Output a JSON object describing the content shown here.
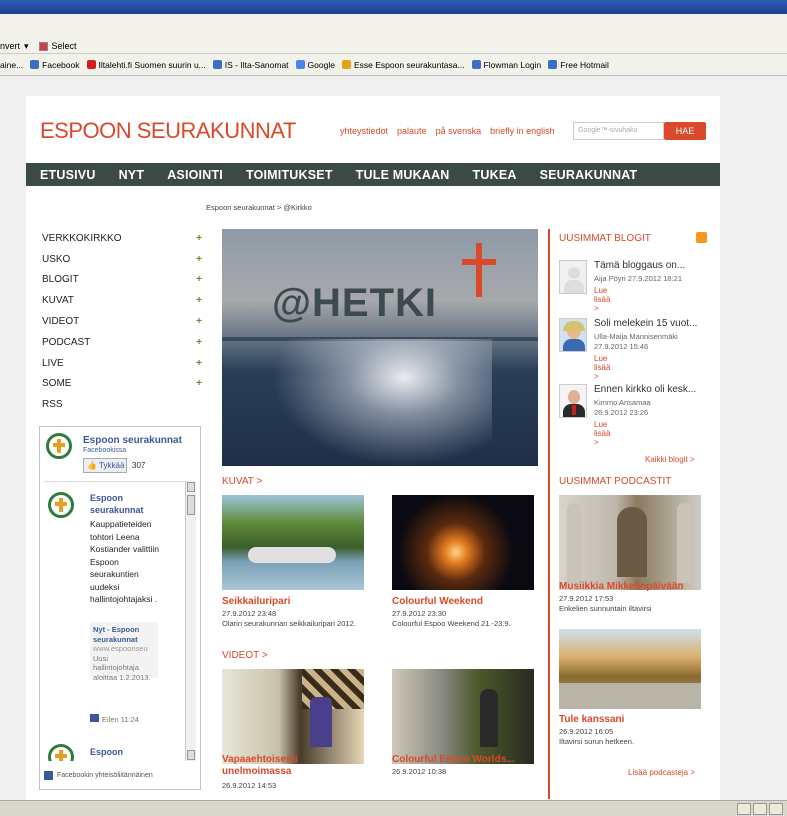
{
  "browser": {
    "toolbar_left": [
      "nvert",
      "Select"
    ],
    "favorites": [
      {
        "label": "aine...",
        "color": "#3b6fc4"
      },
      {
        "label": "Facebook",
        "color": "#3b5998"
      },
      {
        "label": "Iltalehti.fi  Suomen suurin u...",
        "color": "#d02020"
      },
      {
        "label": "IS - Ilta-Sanomat",
        "color": "#3b6fc4"
      },
      {
        "label": "Google",
        "color": "#4a86e8"
      },
      {
        "label": "Esse  Espoon seurakuntasa...",
        "color": "#e5a020"
      },
      {
        "label": "Flowman Login",
        "color": "#3b6fc4"
      },
      {
        "label": "Free Hotmail",
        "color": "#3b6fc4"
      }
    ]
  },
  "header": {
    "logo": "ESPOON SEURAKUNNAT",
    "links": [
      "yhteystiedot",
      "palaute",
      "på svenska",
      "briefly in english"
    ],
    "search_placeholder": "Google™-sivuhaku",
    "search_button": "HAE"
  },
  "mainnav": [
    "ETUSIVU",
    "NYT",
    "ASIOINTI",
    "TOIMITUKSET",
    "TULE MUKAAN",
    "TUKEA",
    "SEURAKUNNAT"
  ],
  "breadcrumb": "Espoon seurakunnat > @Kirkko",
  "sidenav": [
    {
      "label": "VERKKOKIRKKO",
      "plus": "+"
    },
    {
      "label": "USKO",
      "plus": "+"
    },
    {
      "label": "BLOGIT",
      "plus": "+"
    },
    {
      "label": "KUVAT",
      "plus": "+"
    },
    {
      "label": "VIDEOT",
      "plus": "+"
    },
    {
      "label": "PODCAST",
      "plus": "+"
    },
    {
      "label": "LIVE",
      "plus": "+"
    },
    {
      "label": "SOME",
      "plus": "+"
    },
    {
      "label": "RSS",
      "plus": ""
    }
  ],
  "facebook": {
    "page_name": "Espoon seurakunnat",
    "sub": "Facebookissa",
    "like": "Tykkää",
    "like_count": "307",
    "post_name": "Espoon seurakunnat",
    "post_text": "Kauppatieteiden tohtori Leena Kostiander valittiin Espoon seurakuntien uudeksi hallintojohtajaksi .",
    "share_title": "Nyt - Espoon seurakunnat",
    "share_url": "www.espoonseu",
    "share_desc": "Uusi hallintojohtaja aloittaa 1.2.2013.",
    "post_time": "Eilen 11:24",
    "post2_name": "Espoon",
    "footer": "Facebookin yhteisöliitännäinen"
  },
  "hero": {
    "title": "@HETKI"
  },
  "kuvat": {
    "heading": "KUVAT >",
    "items": [
      {
        "title": "Seikkailuripari",
        "date": "27.9.2012 23:48",
        "desc": "Olarin seurakunnan seikkailuripari 2012."
      },
      {
        "title": "Colourful Weekend",
        "date": "27.9.2012 23:30",
        "desc": "Colourful Espoo Weekend 21.-23.9."
      }
    ]
  },
  "videot": {
    "heading": "VIDEOT >",
    "items": [
      {
        "title": "Vapaaehtoisesti unelmoimassa",
        "date": "26.9.2012 14:53"
      },
      {
        "title": "Colourful Espoo Worlds...",
        "date": "26.9.2012 10:38"
      }
    ]
  },
  "blogit": {
    "heading": "UUSIMMAT BLOGIT",
    "items": [
      {
        "title": "Tämä bloggaus on...",
        "author": "Aija Pöyri",
        "date": "27.9.2012 18:21",
        "more": "Lue lisää >"
      },
      {
        "title": "Soli melekein 15 vuot...",
        "author": "Ulla-Maija Mannisenmäki",
        "date": "27.9.2012 15:46",
        "more": "Lue lisää >"
      },
      {
        "title": "Ennen kirkko oli kesk...",
        "author": "Kimmo Ansamaa",
        "date": "26.9.2012 23:26",
        "more": "Lue lisää >"
      }
    ],
    "all": "Kaikki blogit >"
  },
  "podcastit": {
    "heading": "UUSIMMAT PODCASTIT",
    "items": [
      {
        "title": "Musiikkia Mikkelinpäivään",
        "date": "27.9.2012 17:53",
        "desc": "Enkelien sunnuntain iltavirsi"
      },
      {
        "title": "Tule kanssani",
        "date": "26.9.2012 16:05",
        "desc": "Iltavirsi surun hetkeen."
      }
    ],
    "all": "Lisää podcasteja >"
  }
}
